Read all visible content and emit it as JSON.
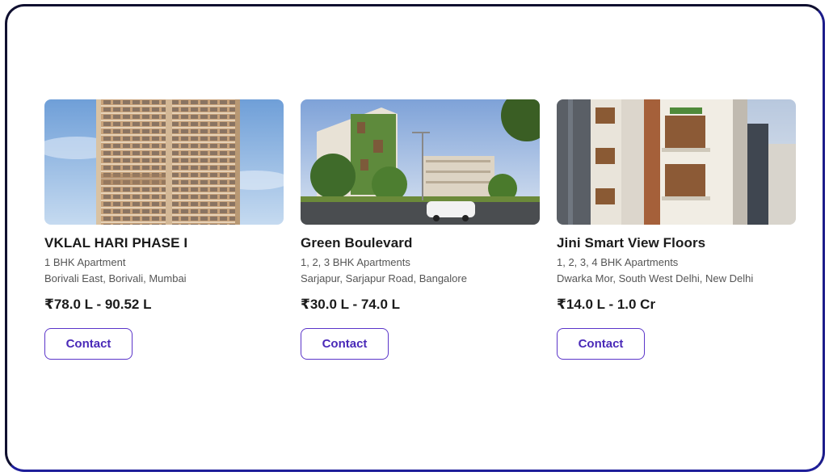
{
  "accent_color": "#5b35c9",
  "frame_color": "#1e1e9a",
  "properties": [
    {
      "name": "VKLAL HARI PHASE I",
      "type": "1 BHK Apartment",
      "location": "Borivali East, Borivali, Mumbai",
      "price": "₹78.0 L - 90.52 L",
      "contact_label": "Contact",
      "image_icon": "building-tower-photo"
    },
    {
      "name": "Green Boulevard",
      "type": "1, 2, 3 BHK Apartments",
      "location": "Sarjapur, Sarjapur Road, Bangalore",
      "price": "₹30.0 L - 74.0 L",
      "contact_label": "Contact",
      "image_icon": "green-apartment-complex-photo"
    },
    {
      "name": "Jini Smart View Floors",
      "type": "1, 2, 3, 4 BHK Apartments",
      "location": "Dwarka Mor, South West Delhi, New Delhi",
      "price": "₹14.0 L - 1.0 Cr",
      "contact_label": "Contact",
      "image_icon": "builder-floor-photo"
    }
  ]
}
